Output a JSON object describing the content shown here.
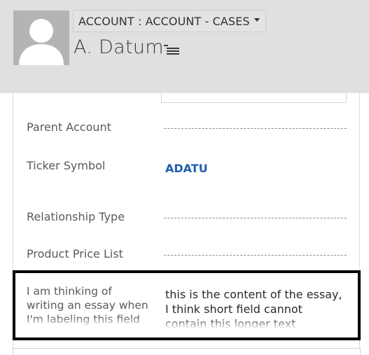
{
  "header": {
    "breadcrumb": "ACCOUNT : ACCOUNT - CASES",
    "record_name": "A. Datum",
    "avatar_icon": "person-silhouette-icon",
    "breadcrumb_icon": "chevron-down-icon",
    "menu_icon": "menu-lines-icon",
    "background_color": "#e0e0e0"
  },
  "form": {
    "fields": [
      {
        "label": "Parent Account",
        "value": ""
      },
      {
        "label": "Ticker Symbol",
        "value": "ADATU"
      },
      {
        "label": "Relationship Type",
        "value": ""
      },
      {
        "label": "Product Price List",
        "value": ""
      }
    ],
    "essay_field": {
      "label": "I am thinking of writing an essay when I'm labeling this field",
      "value": "this is the content of the essay, I think short field cannot contain this longer text"
    }
  },
  "colors": {
    "link": "#1f5fae",
    "label": "#5a5a5a",
    "highlight_border": "#000000"
  }
}
